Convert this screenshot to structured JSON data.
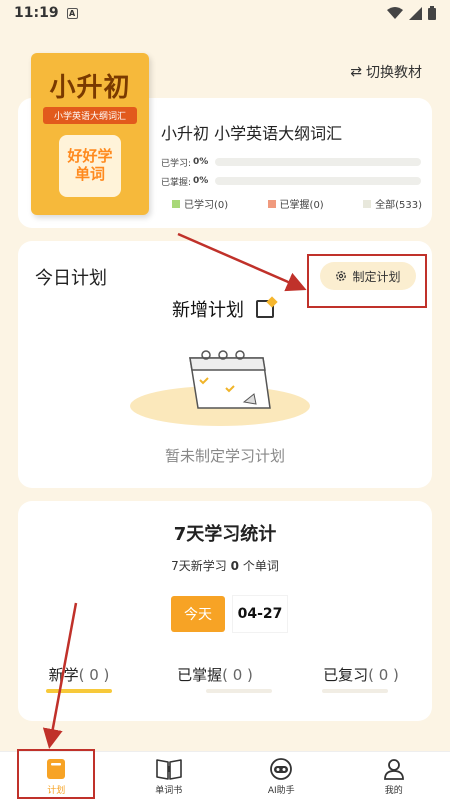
{
  "status": {
    "time": "11:19",
    "app_badge": "A"
  },
  "header": {
    "switch_label": "切换教材"
  },
  "book": {
    "cover_title": "小升初",
    "cover_subtitle": "小学英语大纲词汇",
    "cover_slogan_1": "好好学",
    "cover_slogan_2": "单词",
    "title": "小升初 小学英语大纲词汇",
    "progress": [
      {
        "label": "已学习:",
        "percent": "0%"
      },
      {
        "label": "已掌握:",
        "percent": "0%"
      }
    ],
    "legend": [
      {
        "label": "已学习(0)",
        "color": "#a8d878"
      },
      {
        "label": "已掌握(0)",
        "color": "#f09a7e"
      },
      {
        "label": "全部(533)",
        "color": "#e8e8dc"
      }
    ]
  },
  "plan": {
    "title": "今日计划",
    "make_plan_label": "制定计划",
    "new_plan_label": "新增计划",
    "empty_text": "暂未制定学习计划"
  },
  "stats": {
    "title": "7天学习统计",
    "subtitle_prefix": "7天新学习",
    "subtitle_count": "0",
    "subtitle_suffix": "个单词",
    "today_label": "今天",
    "date_label": "04-27",
    "items": [
      {
        "label": "新学",
        "value": "( 0 )"
      },
      {
        "label": "已掌握",
        "value": "( 0 )"
      },
      {
        "label": "已复习",
        "value": "( 0 )"
      }
    ]
  },
  "nav": [
    {
      "label": "计划",
      "icon": "bookmark-icon",
      "active": true
    },
    {
      "label": "单词书",
      "icon": "book-icon"
    },
    {
      "label": "AI助手",
      "icon": "robot-icon"
    },
    {
      "label": "我的",
      "icon": "person-icon"
    }
  ],
  "colors": {
    "accent": "#f7a325",
    "annotation": "#c0312a",
    "background": "#fcf4e4"
  }
}
